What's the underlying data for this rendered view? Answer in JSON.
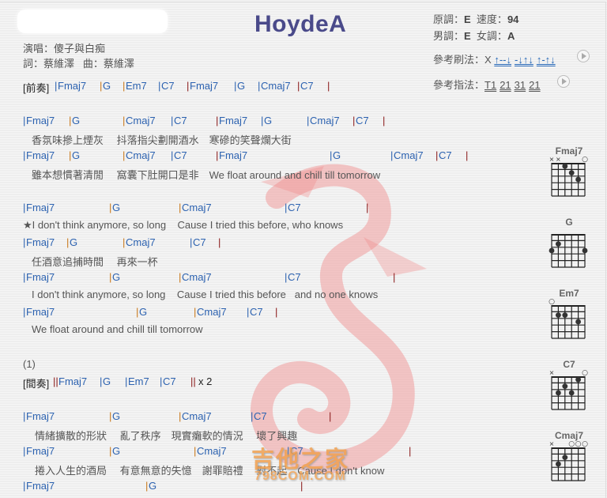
{
  "header": {
    "title": "HoydeA",
    "singer_label": "演唱：",
    "singer": "傻子與白痴",
    "lyricist_label": "詞：",
    "lyricist": "蔡維澤",
    "composer_label": "曲：",
    "composer": "蔡維澤"
  },
  "info": {
    "original_key_label": "原調：",
    "original_key": "E",
    "tempo_label": "速度：",
    "tempo": "94",
    "male_key_label": "男調：",
    "male_key": "E",
    "female_key_label": "女調：",
    "female_key": "A",
    "strum_label": "參考刷法：",
    "strum_prefix": "X",
    "strum_groups": [
      "↑--↓",
      "-↓↑↓",
      "↑-↑↓"
    ],
    "finger_label": "參考指法：",
    "finger_groups": [
      "T1",
      "21",
      "31",
      "21"
    ]
  },
  "sheet": {
    "intro_label": "[前奏]",
    "intro_chords": [
      "Fmaj7",
      "G",
      "Em7",
      "C7",
      "Fmaj7",
      "G",
      "Cmaj7",
      "C7"
    ],
    "verse1_chords_a": [
      "Fmaj7",
      "G",
      "Cmaj7",
      "C7",
      "Fmaj7",
      "G",
      "Cmaj7",
      "C7"
    ],
    "verse1_lyric_a": "香氛味摻上煙灰　 抖落指尖劃開酒水　寒磣的笑聲爛大街",
    "verse1_chords_b": [
      "Fmaj7",
      "G",
      "Cmaj7",
      "C7",
      "Fmaj7",
      "G",
      "Cmaj7",
      "C7"
    ],
    "verse1_lyric_b": "雖本想慣著清閒　 窩囊下肚開口是非　We float around and chill till tomorrow",
    "chorus_chords_a": [
      "Fmaj7",
      "G",
      "Cmaj7",
      "C7"
    ],
    "chorus_lyric_a": "★I don't think anymore, so long    Cause I tried this before, who knows",
    "chorus_chords_b": [
      "Fmaj7",
      "G",
      "Cmaj7",
      "C7"
    ],
    "chorus_lyric_b": "任酒意追捕時間　 再來一杯",
    "chorus_chords_c": [
      "Fmaj7",
      "G",
      "Cmaj7",
      "C7"
    ],
    "chorus_lyric_c": "I don't think anymore, so long    Cause I tried this before   and no one knows",
    "chorus_chords_d": [
      "Fmaj7",
      "G",
      "Cmaj7",
      "C7"
    ],
    "chorus_lyric_d": "We float around and chill till tomorrow",
    "marker": "(1)",
    "interlude_label": "[間奏]",
    "interlude_chords": [
      "Fmaj7",
      "G",
      "Em7",
      "C7"
    ],
    "interlude_repeat": "x 2",
    "verse2_chords_a": [
      "Fmaj7",
      "G",
      "Cmaj7",
      "C7"
    ],
    "verse2_lyric_a": "情緒擴散的形狀　 亂了秩序　現實癱軟的情況　 壞了興趣",
    "verse2_chords_b": [
      "Fmaj7",
      "G",
      "Cmaj7",
      "C7"
    ],
    "verse2_lyric_b": "捲入人生的酒局　 有意無意的失憶　謝罪賠禮　 對不起　Cause I don't know",
    "verse2_chords_c": [
      "Fmaj7",
      "G"
    ]
  },
  "watermark": {
    "name": "吉他之家",
    "url": "798COM.COM",
    "color": "#e85050"
  },
  "chord_diagrams": [
    {
      "name": "Fmaj7",
      "top_marks": [
        "x",
        "x",
        "",
        "",
        "",
        "o"
      ]
    },
    {
      "name": "G",
      "top_marks": [
        "",
        "",
        "",
        "",
        "",
        ""
      ]
    },
    {
      "name": "Em7",
      "top_marks": [
        "o",
        "",
        "",
        "",
        "",
        ""
      ]
    },
    {
      "name": "C7",
      "top_marks": [
        "x",
        "",
        "",
        "",
        "",
        "o"
      ]
    },
    {
      "name": "Cmaj7",
      "top_marks": [
        "x",
        "",
        "",
        "o",
        "o",
        "o"
      ]
    }
  ]
}
